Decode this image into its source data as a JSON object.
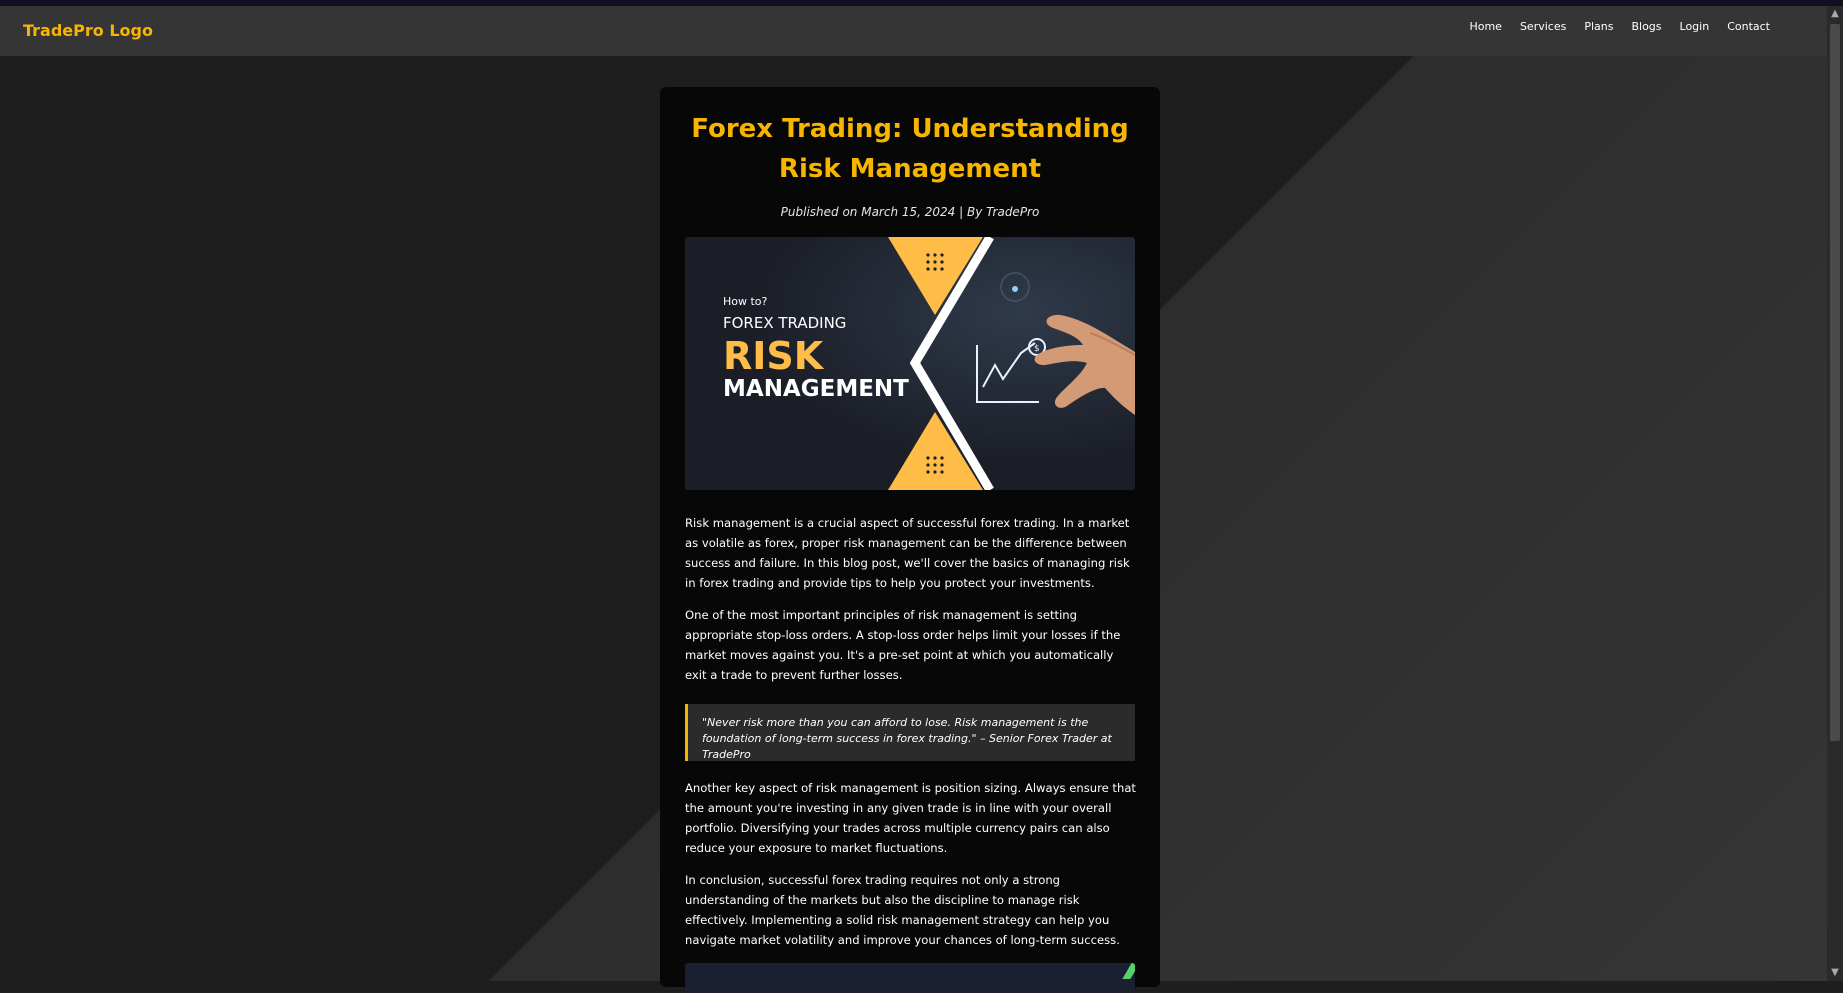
{
  "nav": {
    "logo": "TradePro Logo",
    "links": [
      "Home",
      "Services",
      "Plans",
      "Blogs",
      "Login",
      "Contact"
    ]
  },
  "article": {
    "title": "Forex Trading: Understanding Risk Management",
    "meta": "Published on March 15, 2024 | By TradePro",
    "image": {
      "how": "How to?",
      "forex": "FOREX TRADING",
      "risk": "RISK",
      "management": "MANAGEMENT"
    },
    "paragraphs": [
      "Risk management is a crucial aspect of successful forex trading. In a market as volatile as forex, proper risk management can be the difference between success and failure. In this blog post, we'll cover the basics of managing risk in forex trading and provide tips to help you protect your investments.",
      "One of the most important principles of risk management is setting appropriate stop-loss orders. A stop-loss order helps limit your losses if the market moves against you. It's a pre-set point at which you automatically exit a trade to prevent further losses.",
      "Another key aspect of risk management is position sizing. Always ensure that the amount you're investing in any given trade is in line with your overall portfolio. Diversifying your trades across multiple currency pairs can also reduce your exposure to market fluctuations.",
      "In conclusion, successful forex trading requires not only a strong understanding of the markets but also the discipline to manage risk effectively. Implementing a solid risk management strategy can help you navigate market volatility and improve your chances of long-term success."
    ],
    "quote": "\"Never risk more than you can afford to lose. Risk management is the foundation of long-term success in forex trading.\" – Senior Forex Trader at TradePro"
  },
  "colors": {
    "accent": "#f7b500",
    "navbar": "#353535",
    "card": "#070707",
    "background": "#1e1e1e"
  },
  "icons": {
    "scroll_up": "chevron-up-icon",
    "scroll_down": "chevron-down-icon"
  }
}
